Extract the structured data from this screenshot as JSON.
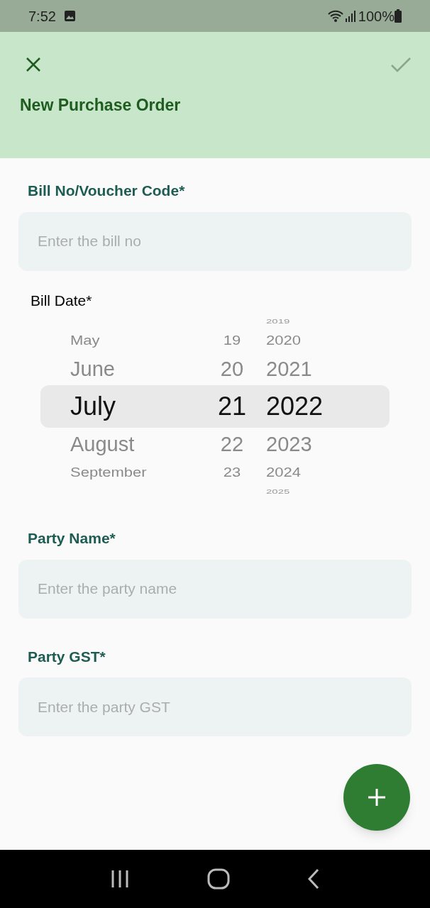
{
  "status_bar": {
    "time": "7:52",
    "battery": "100%"
  },
  "header": {
    "title": "New Purchase Order"
  },
  "fields": [
    {
      "label": "Bill No/Voucher Code*",
      "placeholder": "Enter the bill no"
    }
  ],
  "date_picker": {
    "label": "Bill Date*",
    "columns": [
      {
        "kind": "month",
        "items": [
          {
            "text": "May",
            "selected": false
          },
          {
            "text": "June",
            "selected": false
          },
          {
            "text": "July",
            "selected": true
          },
          {
            "text": "August",
            "selected": false
          },
          {
            "text": "September",
            "selected": false
          }
        ]
      },
      {
        "kind": "day",
        "items": [
          {
            "text": "19",
            "selected": false
          },
          {
            "text": "20",
            "selected": false
          },
          {
            "text": "21",
            "selected": true
          },
          {
            "text": "22",
            "selected": false
          },
          {
            "text": "23",
            "selected": false
          }
        ]
      },
      {
        "kind": "year",
        "items": [
          {
            "text": "2019",
            "selected": false
          },
          {
            "text": "2020",
            "selected": false
          },
          {
            "text": "2021",
            "selected": false
          },
          {
            "text": "2022",
            "selected": true
          },
          {
            "text": "2023",
            "selected": false
          },
          {
            "text": "2024",
            "selected": false
          },
          {
            "text": "2025",
            "selected": false
          }
        ]
      }
    ]
  },
  "fields_after": [
    {
      "label": "Party Name*",
      "placeholder": "Enter the party name"
    },
    {
      "label": "Party GST*",
      "placeholder": "Enter the party GST"
    }
  ]
}
